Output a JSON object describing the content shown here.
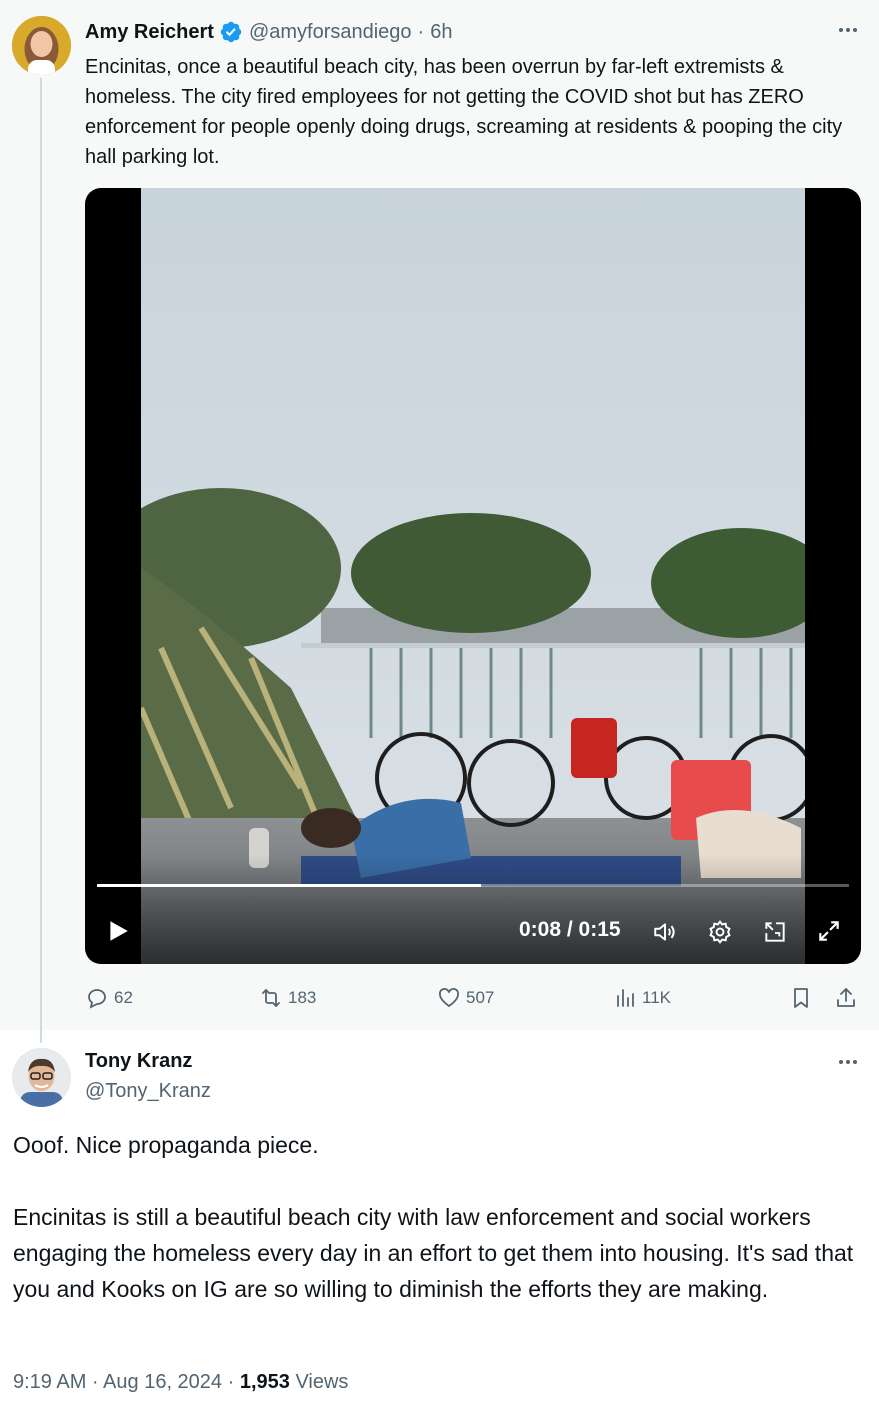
{
  "parent_tweet": {
    "author_name": "Amy Reichert",
    "author_handle": "@amyforsandiego",
    "time_separator": "·",
    "time_ago": "6h",
    "verified_badge_color": "#1d9bf0",
    "text": "Encinitas, once a beautiful beach city, has been overrun by far-left extremists & homeless. The city fired employees for not getting the COVID shot but has ZERO enforcement for people openly doing drugs, screaming at residents & pooping the city hall parking lot.",
    "video": {
      "current_time": "0:08",
      "duration": "0:15",
      "time_display": "0:08 / 0:15",
      "progress_fraction": 0.51
    },
    "stats": {
      "replies": "62",
      "reposts": "183",
      "likes": "507",
      "views": "11K"
    }
  },
  "reply_tweet": {
    "author_name": "Tony Kranz",
    "author_handle": "@Tony_Kranz",
    "text": "Ooof. Nice propaganda piece.\n\nEncinitas is still a beautiful beach city with law enforcement and social workers engaging the homeless every day in an effort to get them into housing. It's sad that you and Kooks on IG are so willing to diminish the efforts they are making.",
    "timestamp": "9:19 AM · Aug 16, 2024 · ",
    "view_count": "1,953",
    "views_label": " Views"
  },
  "icons": {
    "more": "more-horizontal-icon",
    "reply": "reply-icon",
    "repost": "repost-icon",
    "like": "heart-icon",
    "views": "analytics-icon",
    "bookmark": "bookmark-icon",
    "share": "share-icon",
    "play": "play-icon",
    "volume": "volume-icon",
    "settings": "gear-icon",
    "pip": "picture-in-picture-icon",
    "fullscreen": "fullscreen-icon"
  }
}
